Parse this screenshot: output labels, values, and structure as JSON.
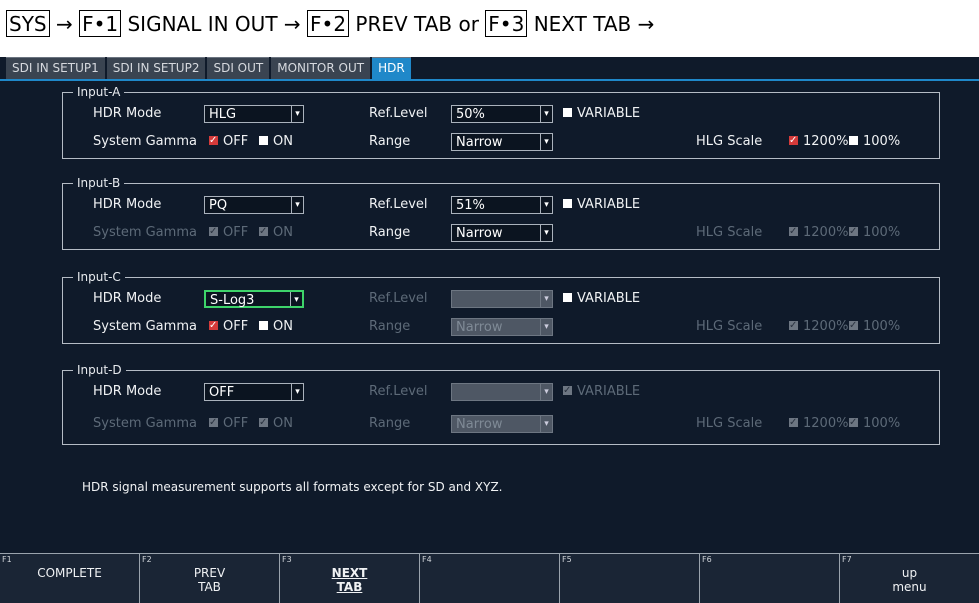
{
  "breadcrumb": {
    "sys": "SYS",
    "arrow": "→",
    "f1_key": "F•1",
    "f1_text": "SIGNAL IN OUT",
    "f2_key": "F•2",
    "f2_text": "PREV TAB or",
    "f3_key": "F•3",
    "f3_text": "NEXT TAB"
  },
  "tabs": [
    "SDI IN SETUP1",
    "SDI IN SETUP2",
    "SDI OUT",
    "MONITOR OUT",
    "HDR"
  ],
  "active_tab": "HDR",
  "labels": {
    "hdr_mode": "HDR Mode",
    "system_gamma": "System Gamma",
    "ref_level": "Ref.Level",
    "range": "Range",
    "hlg_scale": "HLG Scale",
    "variable": "VARIABLE",
    "off": "OFF",
    "on": "ON",
    "scale_1200": "1200%",
    "scale_100": "100%"
  },
  "inputs": [
    {
      "name": "Input-A",
      "hdr_mode": "HLG",
      "ref_level": "50%",
      "range": "Narrow"
    },
    {
      "name": "Input-B",
      "hdr_mode": "PQ",
      "ref_level": "51%",
      "range": "Narrow"
    },
    {
      "name": "Input-C",
      "hdr_mode": "S-Log3",
      "ref_level": "",
      "range": "Narrow"
    },
    {
      "name": "Input-D",
      "hdr_mode": "OFF",
      "ref_level": "",
      "range": "Narrow"
    }
  ],
  "note": "HDR signal measurement supports all formats except for SD and XYZ.",
  "fkeys": [
    {
      "num": "F1",
      "label": "COMPLETE"
    },
    {
      "num": "F2",
      "label": "PREV\nTAB"
    },
    {
      "num": "F3",
      "label": "NEXT\nTAB"
    },
    {
      "num": "F4",
      "label": ""
    },
    {
      "num": "F5",
      "label": ""
    },
    {
      "num": "F6",
      "label": ""
    },
    {
      "num": "F7",
      "label": "up\nmenu"
    }
  ],
  "colors": {
    "background": "#0f1a2a",
    "active_tab": "#1f88c9",
    "checked": "#d43a3a",
    "focus": "#3ed46a"
  }
}
